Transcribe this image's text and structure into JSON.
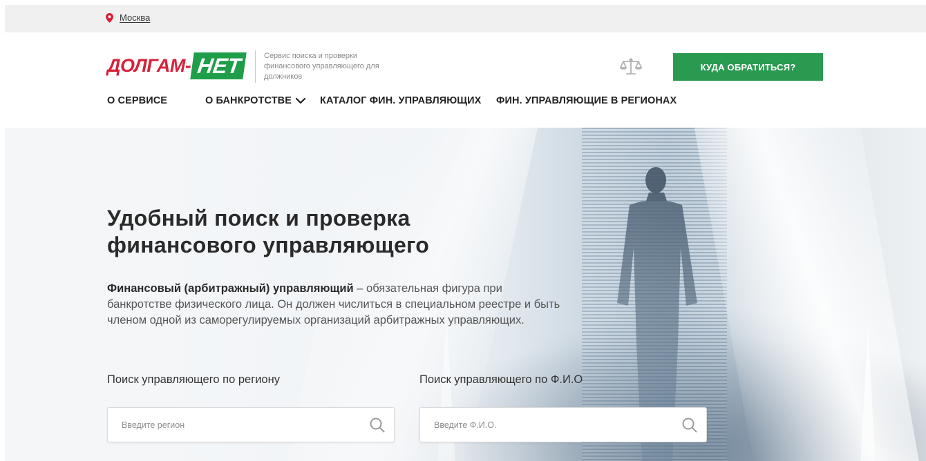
{
  "city_bar": {
    "city": "Москва"
  },
  "header": {
    "logo_part1": "ДОЛГАМ-",
    "logo_part2": "НЕТ",
    "tagline": "Сервис поиска и проверки финансового управляющего для должников",
    "scales_icon": "scales-icon",
    "cta_label": "КУДА ОБРАТИТЬСЯ?"
  },
  "nav": {
    "items": [
      {
        "label": "О СЕРВИСЕ"
      },
      {
        "label": "О БАНКРОТСТВЕ"
      },
      {
        "label": "КАТАЛОГ ФИН. УПРАВЛЯЮЩИХ"
      },
      {
        "label": "ФИН. УПРАВЛЯЮЩИЕ В РЕГИОНАХ"
      }
    ]
  },
  "hero": {
    "title": "Удобный поиск и проверка финансового управляющего",
    "lead_bold": "Финансовый (арбитражный) управляющий",
    "lead_rest": " – обязательная фигура при банкротстве физического лица. Он должен числиться в специальном реестре и быть членом одной из саморегулируемых организаций арбитражных управляющих."
  },
  "search": {
    "region": {
      "label": "Поиск управляющего по региону",
      "placeholder": "Введите регион"
    },
    "name": {
      "label": "Поиск управляющего по Ф.И.О",
      "placeholder": "Введите Ф.И.О."
    }
  },
  "colors": {
    "brand_red": "#d8203a",
    "brand_green": "#1f9e49",
    "cta_green": "#2b9a51"
  }
}
